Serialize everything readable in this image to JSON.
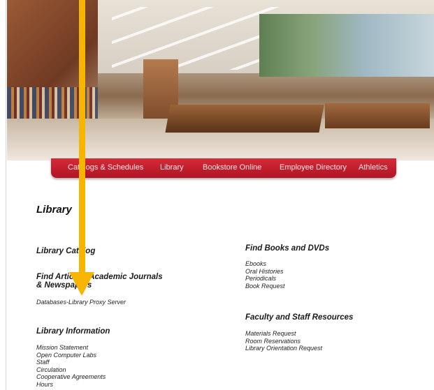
{
  "nav": {
    "items": [
      {
        "label": "Catalogs & Schedules"
      },
      {
        "label": "Library"
      },
      {
        "label": "Bookstore Online"
      },
      {
        "label": "Employee Directory"
      },
      {
        "label": "Athletics"
      }
    ]
  },
  "page": {
    "title": "Library",
    "left": {
      "library_catalog": "Library Catalog",
      "find_articles_line1": "Find Articles, Academic Journals",
      "find_articles_line2": "& Newspapers",
      "databases_link": "Databases-Library Proxy Server",
      "library_information": "Library Information",
      "info_links": [
        "Mission Statement",
        "Open Computer Labs",
        "Staff",
        "Circulation",
        "Cooperative Agreements",
        "Hours"
      ]
    },
    "right": {
      "find_books": "Find Books and DVDs",
      "books_links": [
        "Ebooks",
        "Oral Histories",
        "Periodicals",
        "Book Request"
      ],
      "faculty_resources": "Faculty and Staff Resources",
      "faculty_links": [
        "Materials Request",
        "Room Reservations",
        "Library Orientation Request"
      ]
    }
  },
  "colors": {
    "nav_red": "#c41e2c",
    "arrow": "#f7b400"
  },
  "annotation": {
    "icon": "down-arrow-icon"
  }
}
